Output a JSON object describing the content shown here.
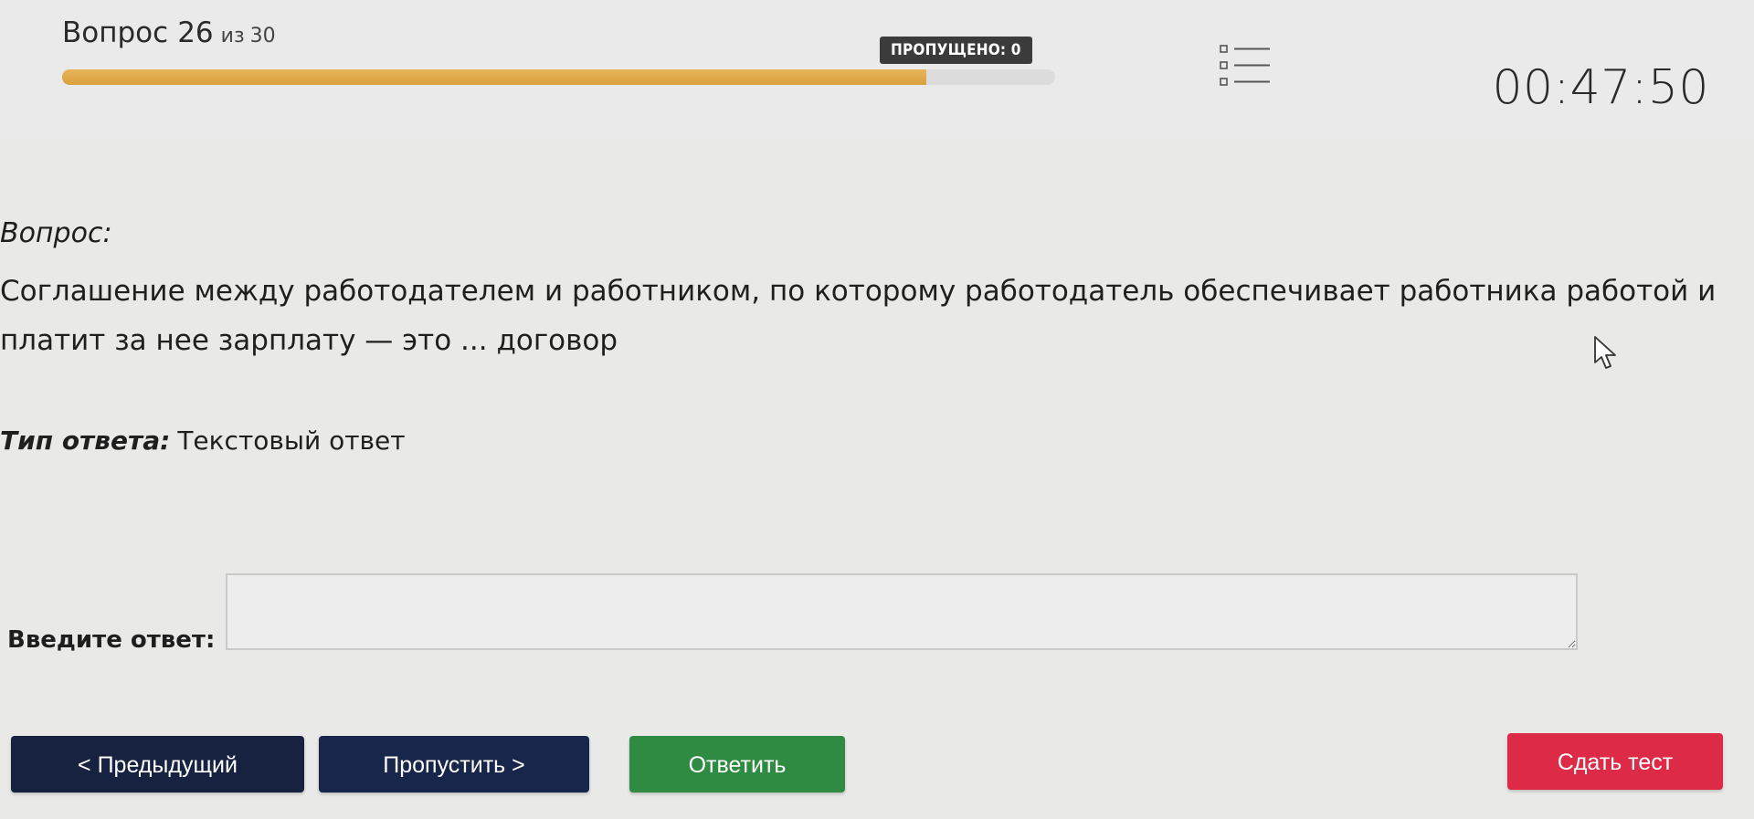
{
  "header": {
    "question_word": "Вопрос",
    "question_number": "26",
    "of_word": "из",
    "total_questions": "30",
    "progress_fraction": 0.87,
    "skipped_badge": "ПРОПУЩЕНО: 0",
    "list_icon": "question-list-icon",
    "timer": "00:47:50"
  },
  "question": {
    "label": "Вопрос:",
    "text": "Соглашение между работодателем и работником, по которому работодатель обеспечивает работника работой и платит за нее зарплату — это ... договор",
    "answer_type_label": "Тип ответа:",
    "answer_type_value": "Текстовый ответ"
  },
  "answer": {
    "label": "Введите ответ:",
    "value": "",
    "placeholder": ""
  },
  "buttons": {
    "prev": "< Предыдущий",
    "skip": "Пропустить >",
    "answer": "Ответить",
    "submit": "Сдать тест"
  },
  "colors": {
    "progress": "#d9a13f",
    "prev_button": "#162240",
    "skip_button": "#18264b",
    "answer_button": "#2f8b42",
    "submit_button": "#dc2a47",
    "badge": "#3b3b3b"
  }
}
